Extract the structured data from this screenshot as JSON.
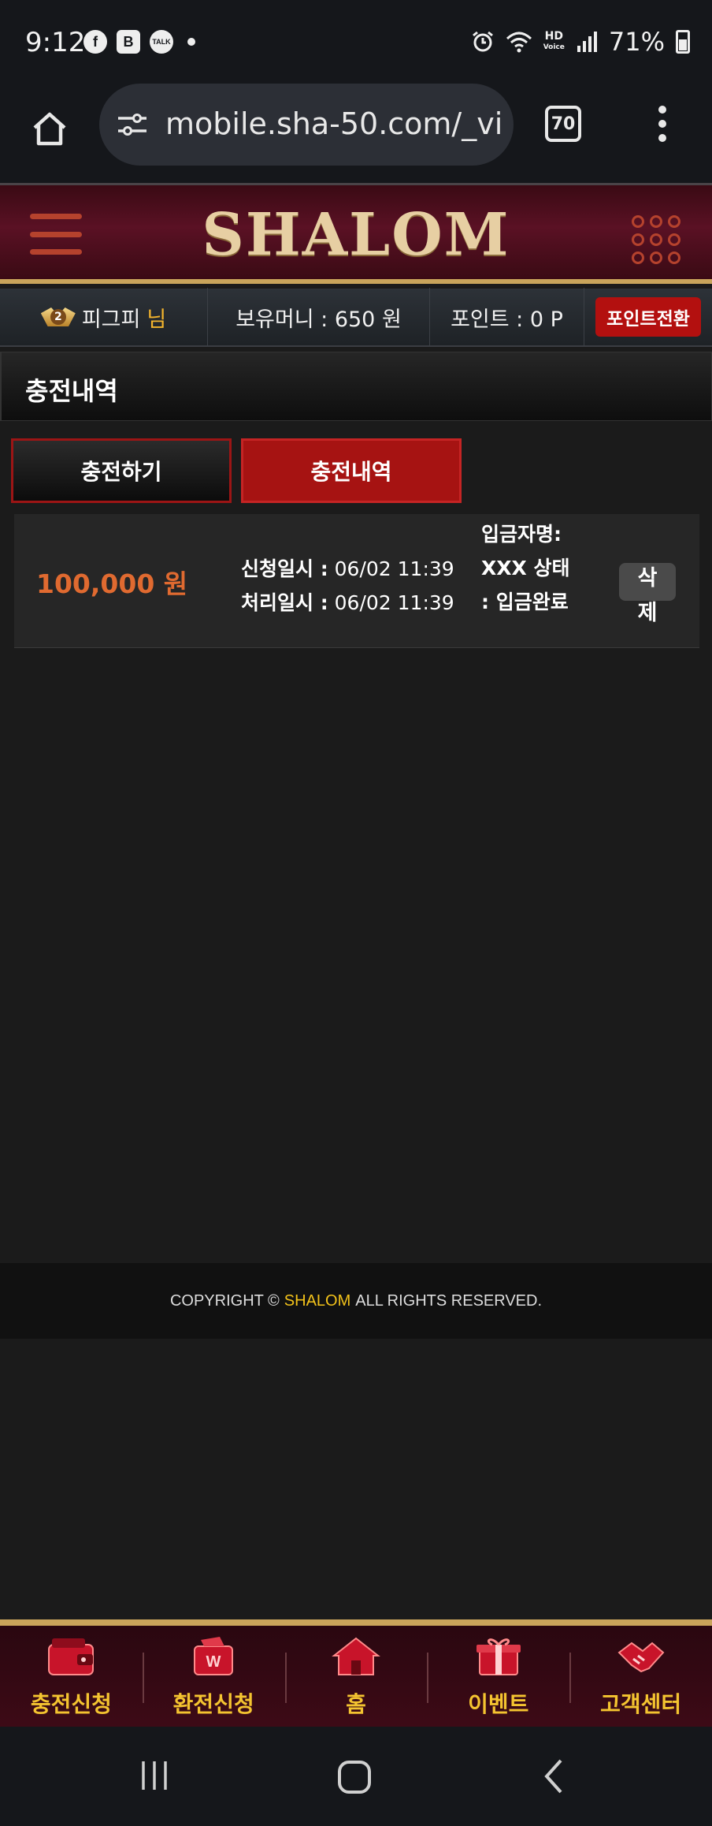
{
  "status_bar": {
    "time": "9:12",
    "battery": "71%",
    "left_icons": [
      "facebook-icon",
      "b-app-icon",
      "kakaotalk-icon",
      "dot-icon"
    ],
    "right_icons": [
      "alarm-icon",
      "wifi-icon",
      "hd-voice-icon",
      "signal-icon",
      "battery-icon"
    ],
    "hd_label": "HD",
    "voice_label": "Voice",
    "b_label": "B",
    "f_label": "f",
    "talk_label": "TALK"
  },
  "browser": {
    "url": "mobile.sha-50.com/_vi",
    "tab_count": "70"
  },
  "site": {
    "logo": "SHALOM",
    "accent_color": "#b3100f",
    "gold_color": "#c9a45b"
  },
  "user_bar": {
    "level": "2",
    "username": "피그피",
    "honorific": "님",
    "money": "보유머니 : 650 원",
    "points": "포인트 : 0 P",
    "point_convert_label": "포인트전환"
  },
  "page": {
    "title": "충전내역"
  },
  "tabs": [
    {
      "label": "충전하기",
      "active": false
    },
    {
      "label": "충전내역",
      "active": true
    }
  ],
  "history": [
    {
      "amount": "100,000 원",
      "request_label": "신청일시 :",
      "request_time": "06/02 11:39",
      "process_label": "처리일시 :",
      "process_time": "06/02 11:39",
      "depositor_label": "입금자명:",
      "depositor": "XXX",
      "status_label": "상태 :",
      "status": "입금완료",
      "delete_label": "삭제"
    }
  ],
  "footer": {
    "prefix": "COPYRIGHT ©",
    "brand": "SHALOM",
    "suffix": "ALL RIGHTS RESERVED."
  },
  "bottom_nav": [
    {
      "label": "충전신청",
      "icon": "wallet-icon"
    },
    {
      "label": "환전신청",
      "icon": "exchange-icon"
    },
    {
      "label": "홈",
      "icon": "home-icon"
    },
    {
      "label": "이벤트",
      "icon": "gift-icon"
    },
    {
      "label": "고객센터",
      "icon": "handshake-icon"
    }
  ]
}
